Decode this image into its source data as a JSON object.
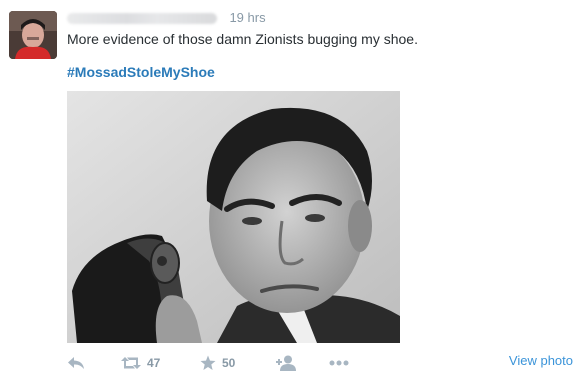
{
  "tweet": {
    "time": "19 hrs",
    "text": "More evidence of those damn Zionists bugging my shoe.",
    "hashtag": "#MossadStoleMyShoe",
    "photo_description": ""
  },
  "actions": {
    "retweet_count": "47",
    "favorite_count": "50",
    "view_photo_label": "View photo"
  },
  "colors": {
    "link": "#2b7bb9",
    "muted": "#8899a6",
    "icon": "#a8b6c2"
  },
  "icons": [
    "reply-icon",
    "retweet-icon",
    "favorite-star-icon",
    "follow-icon",
    "more-dots-icon"
  ]
}
